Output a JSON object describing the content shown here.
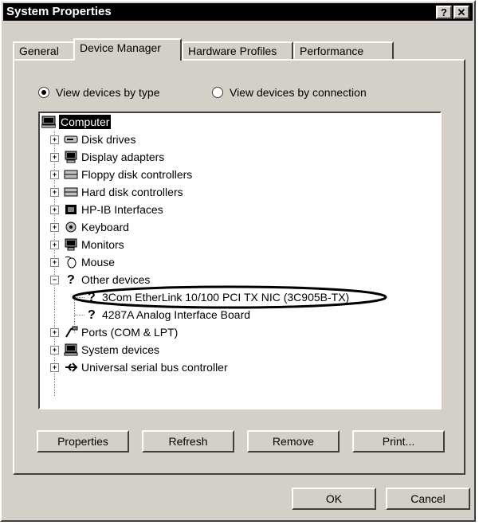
{
  "window": {
    "title": "System Properties",
    "help_btn": "?",
    "close_btn": "✕"
  },
  "tabs": [
    {
      "label": "General",
      "active": false
    },
    {
      "label": "Device Manager",
      "active": true
    },
    {
      "label": "Hardware Profiles",
      "active": false
    },
    {
      "label": "Performance",
      "active": false
    }
  ],
  "view": {
    "by_type": "View devices by type",
    "by_connection": "View devices by connection",
    "selected": "by_type"
  },
  "tree": {
    "root": "Computer",
    "items": [
      {
        "label": "Disk drives",
        "icon": "disk-drive-icon",
        "expander": "+"
      },
      {
        "label": "Display adapters",
        "icon": "display-adapter-icon",
        "expander": "+"
      },
      {
        "label": "Floppy disk controllers",
        "icon": "floppy-controller-icon",
        "expander": "+"
      },
      {
        "label": "Hard disk controllers",
        "icon": "hard-disk-controller-icon",
        "expander": "+"
      },
      {
        "label": "HP-IB Interfaces",
        "icon": "hpib-interface-icon",
        "expander": "+"
      },
      {
        "label": "Keyboard",
        "icon": "keyboard-icon",
        "expander": "+"
      },
      {
        "label": "Monitors",
        "icon": "monitor-icon",
        "expander": "+"
      },
      {
        "label": "Mouse",
        "icon": "mouse-icon",
        "expander": "+"
      },
      {
        "label": "Other devices",
        "icon": "question-icon",
        "expander": "−"
      },
      {
        "label": "3Com EtherLink 10/100 PCI TX NIC (3C905B-TX)",
        "icon": "question-icon",
        "child": true
      },
      {
        "label": "4287A Analog Interface Board",
        "icon": "question-icon",
        "child": true
      },
      {
        "label": "Ports (COM & LPT)",
        "icon": "port-icon",
        "expander": "+"
      },
      {
        "label": "System devices",
        "icon": "system-device-icon",
        "expander": "+"
      },
      {
        "label": "Universal serial bus controller",
        "icon": "usb-icon",
        "expander": "+"
      }
    ]
  },
  "buttons": {
    "properties": "Properties",
    "refresh": "Refresh",
    "remove": "Remove",
    "print": "Print..."
  },
  "footer": {
    "ok": "OK",
    "cancel": "Cancel"
  }
}
